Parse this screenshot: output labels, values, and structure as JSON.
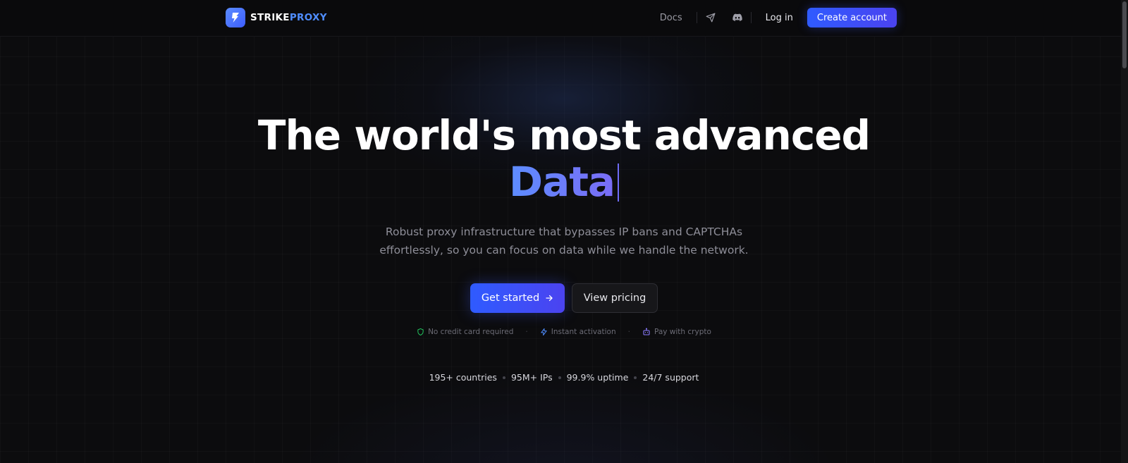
{
  "header": {
    "brand_part1": "STRIKE",
    "brand_part2": "PROXY",
    "docs_label": "Docs",
    "login_label": "Log in",
    "create_account_label": "Create account"
  },
  "hero": {
    "title": "The world's most advanced",
    "rotating_word": "Data",
    "subtitle": "Robust proxy infrastructure that bypasses IP bans and CAPTCHAs effortlessly, so you can focus on data while we handle the network.",
    "primary_cta": "Get started",
    "secondary_cta": "View pricing"
  },
  "features": [
    {
      "label": "No credit card required",
      "icon": "shield-icon"
    },
    {
      "label": "Instant activation",
      "icon": "bolt-icon"
    },
    {
      "label": "Pay with crypto",
      "icon": "robot-icon"
    }
  ],
  "stats": [
    "195+ countries",
    "95M+ IPs",
    "99.9% uptime",
    "24/7 support"
  ],
  "colors": {
    "background": "#0c0c0e",
    "accent": "#3d5dff",
    "brand_blue": "#4f8dff",
    "feature_green": "#22c55e",
    "feature_blue": "#4f8dff",
    "feature_purple": "#8b7cff"
  }
}
